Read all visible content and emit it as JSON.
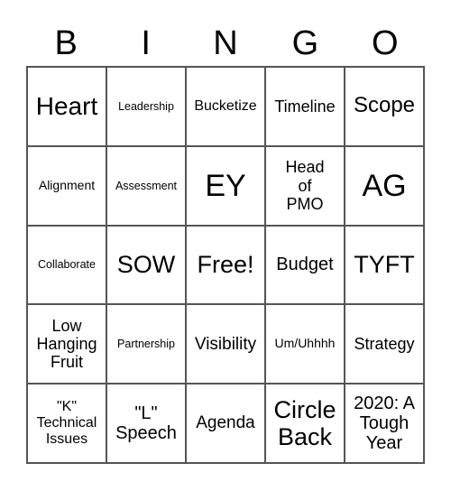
{
  "header": [
    "B",
    "I",
    "N",
    "G",
    "O"
  ],
  "cells": [
    {
      "text": "Heart",
      "size": "s28"
    },
    {
      "text": "Leadership",
      "size": "s12"
    },
    {
      "text": "Bucketize",
      "size": "s16"
    },
    {
      "text": "Timeline",
      "size": "s18"
    },
    {
      "text": "Scope",
      "size": "s24"
    },
    {
      "text": "Alignment",
      "size": "s14"
    },
    {
      "text": "Assessment",
      "size": "s12"
    },
    {
      "text": "EY",
      "size": "s34"
    },
    {
      "text": "Head\nof\nPMO",
      "size": "s18"
    },
    {
      "text": "AG",
      "size": "s34"
    },
    {
      "text": "Collaborate",
      "size": "s12"
    },
    {
      "text": "SOW",
      "size": "s27"
    },
    {
      "text": "Free!",
      "size": "s27"
    },
    {
      "text": "Budget",
      "size": "s20"
    },
    {
      "text": "TYFT",
      "size": "s27"
    },
    {
      "text": "Low\nHanging\nFruit",
      "size": "s18"
    },
    {
      "text": "Partnership",
      "size": "s12"
    },
    {
      "text": "Visibility",
      "size": "s19"
    },
    {
      "text": "Um/Uhhhh",
      "size": "s14"
    },
    {
      "text": "Strategy",
      "size": "s18"
    },
    {
      "text": "\"K\"\nTechnical\nIssues",
      "size": "s16"
    },
    {
      "text": "\"L\"\nSpeech",
      "size": "s20"
    },
    {
      "text": "Agenda",
      "size": "s19"
    },
    {
      "text": "Circle\nBack",
      "size": "s27"
    },
    {
      "text": "2020: A\nTough\nYear",
      "size": "s20"
    }
  ]
}
